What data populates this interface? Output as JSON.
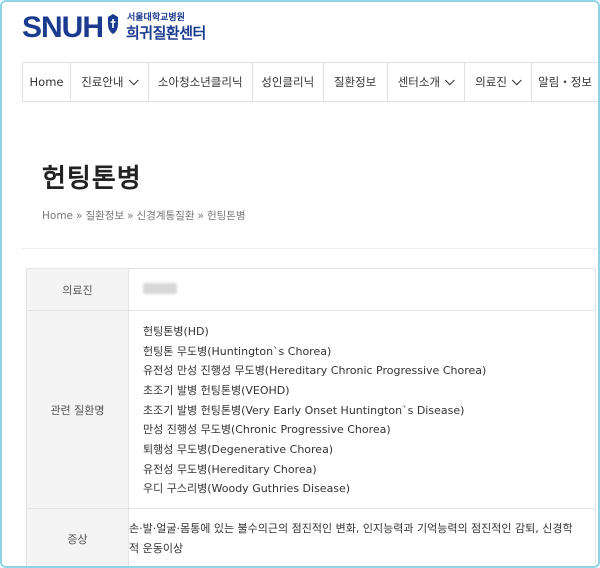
{
  "brand": {
    "logo_text": "SNUH",
    "subtitle": "서울대학교병원",
    "center_name": "희귀질환센터"
  },
  "nav": {
    "items": [
      {
        "label": "Home",
        "has_dropdown": false
      },
      {
        "label": "진료안내",
        "has_dropdown": true
      },
      {
        "label": "소아청소년클리닉",
        "has_dropdown": false
      },
      {
        "label": "성인클리닉",
        "has_dropdown": false
      },
      {
        "label": "질환정보",
        "has_dropdown": false
      },
      {
        "label": "센터소개",
        "has_dropdown": true
      },
      {
        "label": "의료진",
        "has_dropdown": true
      },
      {
        "label": "알림・정보",
        "has_dropdown": false
      }
    ]
  },
  "page": {
    "title": "헌팅톤병",
    "breadcrumb": [
      "Home",
      "질환정보",
      "신경계통질환",
      "헌팅톤병"
    ],
    "breadcrumb_sep": "»"
  },
  "info": {
    "doctor_label": "의료진",
    "related_label": "관련 질환명",
    "related_names": [
      "헌팅톤병(HD)",
      "헌팅톤 무도병(Huntington`s Chorea)",
      "유전성 만성 진행성 무도병(Hereditary Chronic Progressive Chorea)",
      "초조기 발병 헌팅톤병(VEOHD)",
      "초조기 발병 헌팅톤병(Very Early Onset Huntington`s Disease)",
      "만성 진행성 무도병(Chronic Progressive Chorea)",
      "퇴행성 무도병(Degenerative Chorea)",
      "유전성 무도병(Hereditary Chorea)",
      "우디 구스리병(Woody Guthries Disease)"
    ],
    "symptom_label": "증상",
    "symptom_text": "손·발·얼굴·몸통에 있는 불수의근의 점진적인 변화, 인지능력과 기억능력의 점진적인 감퇴, 신경학적 운동이상"
  },
  "colors": {
    "brand_blue": "#1b3b8f",
    "frame_border": "#8fd3e8",
    "table_header_bg": "#f4f4f4"
  }
}
